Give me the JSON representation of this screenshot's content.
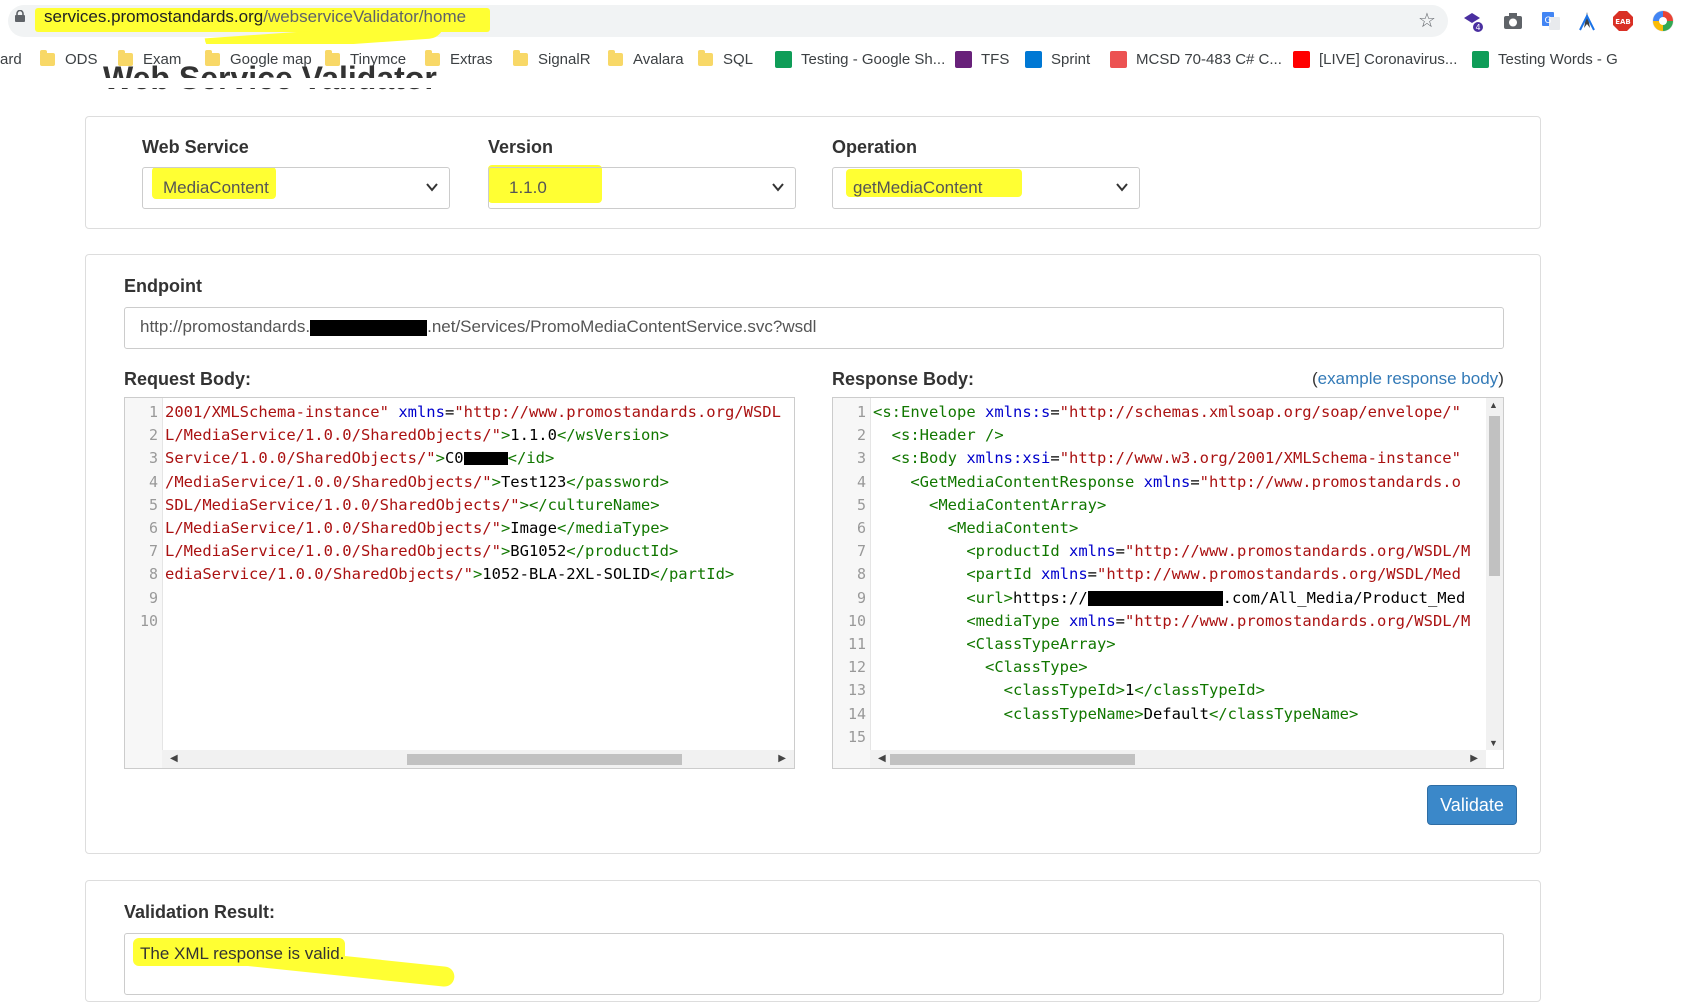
{
  "browser": {
    "url_host": "services.promostandards.org",
    "url_path": "/webserviceValidator/home",
    "bookmarks": [
      {
        "label": "ard",
        "kind": "text"
      },
      {
        "label": "ODS",
        "kind": "folder"
      },
      {
        "label": "Exam",
        "kind": "folder"
      },
      {
        "label": "Google map",
        "kind": "folder"
      },
      {
        "label": "Tinymce",
        "kind": "folder"
      },
      {
        "label": "Extras",
        "kind": "folder"
      },
      {
        "label": "SignalR",
        "kind": "folder"
      },
      {
        "label": "Avalara",
        "kind": "folder"
      },
      {
        "label": "SQL",
        "kind": "folder"
      },
      {
        "label": "Testing - Google Sh...",
        "kind": "sheets"
      },
      {
        "label": "TFS",
        "kind": "vs"
      },
      {
        "label": "Sprint",
        "kind": "devops"
      },
      {
        "label": "MCSD 70-483 C# C...",
        "kind": "udemy"
      },
      {
        "label": "[LIVE] Coronavirus...",
        "kind": "youtube"
      },
      {
        "label": "Testing Words - G",
        "kind": "sheets"
      }
    ],
    "ext_badge": "4"
  },
  "page": {
    "title": "Web Service Validator",
    "web_service_label": "Web Service",
    "web_service_value": "MediaContent",
    "version_label": "Version",
    "version_value": "1.1.0",
    "operation_label": "Operation",
    "operation_value": "getMediaContent",
    "endpoint_label": "Endpoint",
    "endpoint_prefix": "http://promostandards.",
    "endpoint_suffix": ".net/Services/PromoMediaContentService.svc?wsdl",
    "request_label": "Request Body:",
    "response_label": "Response Body:",
    "example_open": "(",
    "example_link": "example response body",
    "example_close": ")",
    "validate_label": "Validate",
    "result_label": "Validation Result:",
    "result_text": "The XML response is valid."
  },
  "request_lines": [
    {
      "n": "1",
      "parts": [
        [
          "str",
          "2001/XMLSchema-instance\""
        ],
        [
          "txtc",
          " "
        ],
        [
          "attr",
          "xmlns"
        ],
        [
          "txtc",
          "="
        ],
        [
          "str",
          "\"http://www.promostandards.org/WSDL"
        ]
      ]
    },
    {
      "n": "2",
      "parts": [
        [
          "str",
          "L/MediaService/1.0.0/SharedObjects/\""
        ],
        [
          "tag",
          ">"
        ],
        [
          "txtc",
          "1.1.0"
        ],
        [
          "tag",
          "</wsVersion>"
        ]
      ]
    },
    {
      "n": "3",
      "parts": [
        [
          "str",
          "Service/1.0.0/SharedObjects/\""
        ],
        [
          "tag",
          ">"
        ],
        [
          "txtc",
          "C0"
        ],
        [
          "redact",
          ""
        ],
        [
          "tag",
          "</id>"
        ]
      ]
    },
    {
      "n": "4",
      "parts": [
        [
          "str",
          "/MediaService/1.0.0/SharedObjects/\""
        ],
        [
          "tag",
          ">"
        ],
        [
          "txtc",
          "Test123"
        ],
        [
          "tag",
          "</password>"
        ]
      ]
    },
    {
      "n": "5",
      "parts": [
        [
          "str",
          "SDL/MediaService/1.0.0/SharedObjects/\""
        ],
        [
          "tag",
          "></cultureName>"
        ]
      ]
    },
    {
      "n": "6",
      "parts": [
        [
          "str",
          "L/MediaService/1.0.0/SharedObjects/\""
        ],
        [
          "tag",
          ">"
        ],
        [
          "txtc",
          "Image"
        ],
        [
          "tag",
          "</mediaType>"
        ]
      ]
    },
    {
      "n": "7",
      "parts": [
        [
          "str",
          "L/MediaService/1.0.0/SharedObjects/\""
        ],
        [
          "tag",
          ">"
        ],
        [
          "txtc",
          "BG1052"
        ],
        [
          "tag",
          "</productId>"
        ]
      ]
    },
    {
      "n": "8",
      "parts": [
        [
          "str",
          "ediaService/1.0.0/SharedObjects/\""
        ],
        [
          "tag",
          ">"
        ],
        [
          "txtc",
          "1052-BLA-2XL-SOLID"
        ],
        [
          "tag",
          "</partId>"
        ]
      ]
    },
    {
      "n": "9",
      "parts": []
    },
    {
      "n": "10",
      "parts": []
    }
  ],
  "response_lines": [
    {
      "n": "1",
      "parts": [
        [
          "tag",
          "<s:Envelope"
        ],
        [
          "txtc",
          " "
        ],
        [
          "attr",
          "xmlns:s"
        ],
        [
          "txtc",
          "="
        ],
        [
          "str",
          "\"http://schemas.xmlsoap.org/soap/envelope/\""
        ]
      ]
    },
    {
      "n": "2",
      "parts": [
        [
          "txtc",
          "  "
        ],
        [
          "tag",
          "<s:Header />"
        ]
      ]
    },
    {
      "n": "3",
      "parts": [
        [
          "txtc",
          "  "
        ],
        [
          "tag",
          "<s:Body"
        ],
        [
          "txtc",
          " "
        ],
        [
          "attr",
          "xmlns:xsi"
        ],
        [
          "txtc",
          "="
        ],
        [
          "str",
          "\"http://www.w3.org/2001/XMLSchema-instance\""
        ]
      ]
    },
    {
      "n": "4",
      "parts": [
        [
          "txtc",
          "    "
        ],
        [
          "tag",
          "<GetMediaContentResponse"
        ],
        [
          "txtc",
          " "
        ],
        [
          "attr",
          "xmlns"
        ],
        [
          "txtc",
          "="
        ],
        [
          "str",
          "\"http://www.promostandards.o"
        ]
      ]
    },
    {
      "n": "5",
      "parts": [
        [
          "txtc",
          "      "
        ],
        [
          "tag",
          "<MediaContentArray>"
        ]
      ]
    },
    {
      "n": "6",
      "parts": [
        [
          "txtc",
          "        "
        ],
        [
          "tag",
          "<MediaContent>"
        ]
      ]
    },
    {
      "n": "7",
      "parts": [
        [
          "txtc",
          "          "
        ],
        [
          "tag",
          "<productId"
        ],
        [
          "txtc",
          " "
        ],
        [
          "attr",
          "xmlns"
        ],
        [
          "txtc",
          "="
        ],
        [
          "str",
          "\"http://www.promostandards.org/WSDL/M"
        ]
      ]
    },
    {
      "n": "8",
      "parts": [
        [
          "txtc",
          "          "
        ],
        [
          "tag",
          "<partId"
        ],
        [
          "txtc",
          " "
        ],
        [
          "attr",
          "xmlns"
        ],
        [
          "txtc",
          "="
        ],
        [
          "str",
          "\"http://www.promostandards.org/WSDL/Med"
        ]
      ]
    },
    {
      "n": "9",
      "parts": [
        [
          "txtc",
          "          "
        ],
        [
          "tag",
          "<url>"
        ],
        [
          "txtc",
          "https://"
        ],
        [
          "redact2",
          ""
        ],
        [
          "txtc",
          ".com/All_Media/Product_Med"
        ]
      ]
    },
    {
      "n": "10",
      "parts": [
        [
          "txtc",
          "          "
        ],
        [
          "tag",
          "<mediaType"
        ],
        [
          "txtc",
          " "
        ],
        [
          "attr",
          "xmlns"
        ],
        [
          "txtc",
          "="
        ],
        [
          "str",
          "\"http://www.promostandards.org/WSDL/M"
        ]
      ]
    },
    {
      "n": "11",
      "parts": [
        [
          "txtc",
          "          "
        ],
        [
          "tag",
          "<ClassTypeArray>"
        ]
      ]
    },
    {
      "n": "12",
      "parts": [
        [
          "txtc",
          "            "
        ],
        [
          "tag",
          "<ClassType>"
        ]
      ]
    },
    {
      "n": "13",
      "parts": [
        [
          "txtc",
          "              "
        ],
        [
          "tag",
          "<classTypeId>"
        ],
        [
          "txtc",
          "1"
        ],
        [
          "tag",
          "</classTypeId>"
        ]
      ]
    },
    {
      "n": "14",
      "parts": [
        [
          "txtc",
          "              "
        ],
        [
          "tag",
          "<classTypeName>"
        ],
        [
          "txtc",
          "Default"
        ],
        [
          "tag",
          "</classTypeName>"
        ]
      ]
    },
    {
      "n": "15",
      "parts": []
    }
  ],
  "colors": {
    "highlight": "#ffff33",
    "button": "#3b88c9",
    "link": "#337ab7"
  }
}
